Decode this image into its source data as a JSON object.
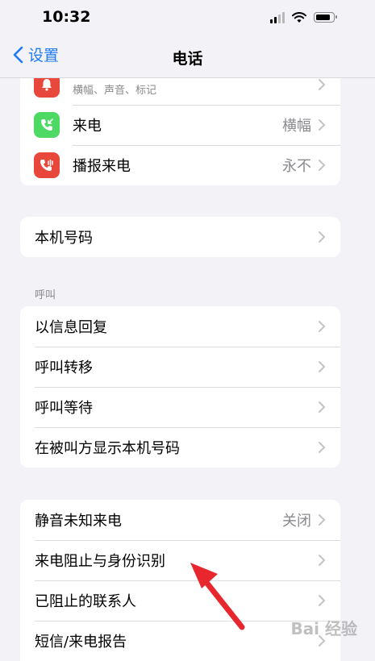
{
  "status_bar": {
    "time": "10:32"
  },
  "nav": {
    "back_label": "设置",
    "title": "电话"
  },
  "group_top": [
    {
      "label": "",
      "subtitle": "横幅、声音、标记",
      "value": "",
      "icon": "bell-icon",
      "icon_color": "#e8473b"
    },
    {
      "label": "来电",
      "value": "横幅",
      "icon": "incoming-call-icon",
      "icon_color": "#4cd964"
    },
    {
      "label": "播报来电",
      "value": "永不",
      "icon": "announce-call-icon",
      "icon_color": "#e8473b"
    }
  ],
  "group_number": [
    {
      "label": "本机号码"
    }
  ],
  "section_call": {
    "header": "呼叫"
  },
  "group_call": [
    {
      "label": "以信息回复"
    },
    {
      "label": "呼叫转移"
    },
    {
      "label": "呼叫等待"
    },
    {
      "label": "在被叫方显示本机号码"
    }
  ],
  "group_block": [
    {
      "label": "静音未知来电",
      "value": "关闭"
    },
    {
      "label": "来电阻止与身份识别"
    },
    {
      "label": "已阻止的联系人"
    },
    {
      "label": "短信/来电报告"
    }
  ],
  "watermark": "Bai 经验",
  "colors": {
    "accent": "#1f7bf2",
    "arrow": "#e8262d"
  }
}
